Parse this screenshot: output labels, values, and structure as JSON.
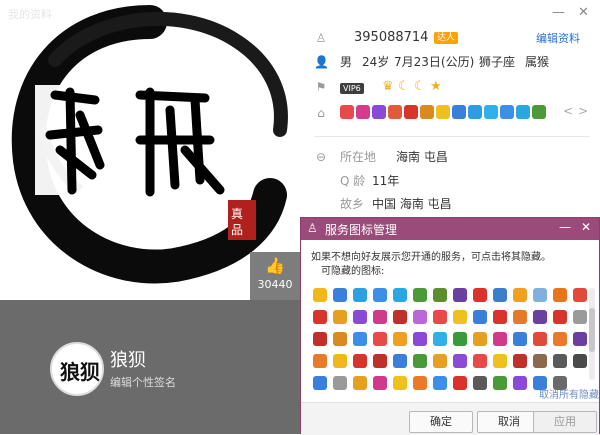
{
  "window": {
    "title": "我的资料"
  },
  "cover": {
    "like_count": "30440",
    "nickname": "狼狈",
    "signature_placeholder": "编辑个性签名",
    "avatar_text": "狼狈"
  },
  "profile": {
    "qq_number": "395088714",
    "badge": "达人",
    "edit_label": "编辑资料",
    "gender": "男",
    "age": "24岁",
    "birthday": "7月23日(公历)",
    "zodiac": "狮子座",
    "chinese_zodiac": "属猴",
    "vip_label": "VIP6",
    "location_label": "所在地",
    "location_value": "海南 屯昌",
    "qage_label": "Q 龄",
    "qage_value": "11年",
    "hometown_label": "故乡",
    "hometown_value": "中国 海南 屯昌"
  },
  "dialog": {
    "title": "服务图标管理",
    "desc_line1": "如果不想向好友展示您开通的服务，可点击将其隐藏。",
    "desc_line2": "可隐藏的图标:",
    "cancel_all_hide": "取消所有隐藏",
    "ok": "确定",
    "cancel": "取消",
    "apply": "应用"
  },
  "colors": {
    "dialog_header": "#9b4b7a",
    "link": "#2a73c8",
    "dark_panel": "#6b6b6b"
  }
}
